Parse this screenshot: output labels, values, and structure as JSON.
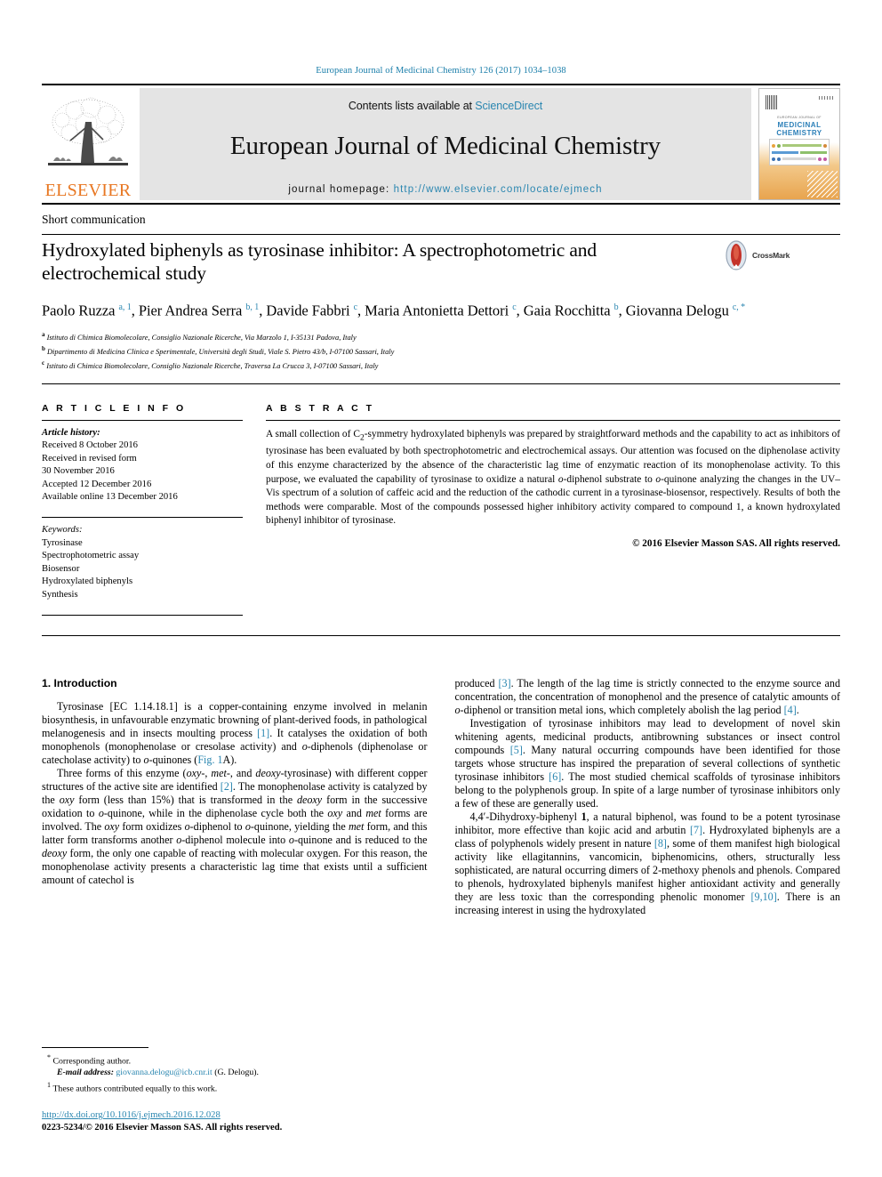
{
  "colors": {
    "link": "#2a86b0",
    "elsevier_orange": "#E87722",
    "band_bg": "#e4e4e4"
  },
  "running_head": "European Journal of Medicinal Chemistry 126 (2017) 1034–1038",
  "masthead": {
    "contents_prefix": "Contents lists available at ",
    "sciencedirect": "ScienceDirect",
    "journal_title": "European Journal of Medicinal Chemistry",
    "homepage_prefix": "journal homepage: ",
    "homepage_url": "http://www.elsevier.com/locate/ejmech",
    "publisher": "ELSEVIER",
    "cover": {
      "line1": "EUROPEAN JOURNAL OF",
      "line2": "MEDICINAL",
      "line3": "CHEMISTRY"
    }
  },
  "article": {
    "type": "Short communication",
    "title": "Hydroxylated biphenyls as tyrosinase inhibitor: A spectrophotometric and electrochemical study",
    "crossmark_label": "CrossMark",
    "authors_html": "Paolo Ruzza <sup>a, 1</sup>, Pier Andrea Serra <sup>b, 1</sup>, Davide Fabbri <sup>c</sup>, Maria Antonietta Dettori <sup>c</sup>, Gaia Rocchitta <sup>b</sup>, Giovanna Delogu <sup>c, *</sup>",
    "affiliations": [
      {
        "mark": "a",
        "text": "Istituto di Chimica Biomolecolare, Consiglio Nazionale Ricerche, Via Marzolo 1, I-35131 Padova, Italy"
      },
      {
        "mark": "b",
        "text": "Dipartimento di Medicina Clinica e Sperimentale, Università degli Studi, Viale S. Pietro 43/b, I-07100 Sassari, Italy"
      },
      {
        "mark": "c",
        "text": "Istituto di Chimica Biomolecolare, Consiglio Nazionale Ricerche, Traversa La Crucca 3, I-07100 Sassari, Italy"
      }
    ]
  },
  "article_info": {
    "heading": "A R T I C L E   I N F O",
    "history_label": "Article history:",
    "history": [
      "Received 8 October 2016",
      "Received in revised form",
      "30 November 2016",
      "Accepted 12 December 2016",
      "Available online 13 December 2016"
    ],
    "keywords_label": "Keywords:",
    "keywords": [
      "Tyrosinase",
      "Spectrophotometric assay",
      "Biosensor",
      "Hydroxylated biphenyls",
      "Synthesis"
    ]
  },
  "abstract": {
    "heading": "A B S T R A C T",
    "text": "A small collection of C2-symmetry hydroxylated biphenyls was prepared by straightforward methods and the capability to act as inhibitors of tyrosinase has been evaluated by both spectrophotometric and electrochemical assays. Our attention was focused on the diphenolase activity of this enzyme characterized by the absence of the characteristic lag time of enzymatic reaction of its monophenolase activity. To this purpose, we evaluated the capability of tyrosinase to oxidize a natural o-diphenol substrate to o-quinone analyzing the changes in the UV–Vis spectrum of a solution of caffeic acid and the reduction of the cathodic current in a tyrosinase-biosensor, respectively. Results of both the methods were comparable. Most of the compounds possessed higher inhibitory activity compared to compound 1, a known hydroxylated biphenyl inhibitor of tyrosinase.",
    "copyright": "© 2016 Elsevier Masson SAS. All rights reserved."
  },
  "body": {
    "section_number_title": "1.  Introduction",
    "left_paragraphs": [
      "Tyrosinase [EC 1.14.18.1] is a copper-containing enzyme involved in melanin biosynthesis, in unfavourable enzymatic browning of plant-derived foods, in pathological melanogenesis and in insects moulting process [1]. It catalyses the oxidation of both monophenols (monophenolase or cresolase activity) and o-diphenols (diphenolase or catecholase activity) to o-quinones (Fig. 1A).",
      "Three forms of this enzyme (oxy-, met-, and deoxy-tyrosinase) with different copper structures of the active site are identified [2]. The monophenolase activity is catalyzed by the oxy form (less than 15%) that is transformed in the deoxy form in the successive oxidation to o-quinone, while in the diphenolase cycle both the oxy and met forms are involved. The oxy form oxidizes o-diphenol to o-quinone, yielding the met form, and this latter form transforms another o-diphenol molecule into o-quinone and is reduced to the deoxy form, the only one capable of reacting with molecular oxygen. For this reason, the monophenolase activity presents a characteristic lag time that exists until a sufficient amount of catechol is"
    ],
    "right_paragraphs": [
      "produced [3]. The length of the lag time is strictly connected to the enzyme source and concentration, the concentration of monophenol and the presence of catalytic amounts of o-diphenol or transition metal ions, which completely abolish the lag period [4].",
      "Investigation of tyrosinase inhibitors may lead to development of novel skin whitening agents, medicinal products, antibrowning substances or insect control compounds [5]. Many natural occurring compounds have been identified for those targets whose structure has inspired the preparation of several collections of synthetic tyrosinase inhibitors [6]. The most studied chemical scaffolds of tyrosinase inhibitors belong to the polyphenols group. In spite of a large number of tyrosinase inhibitors only a few of these are generally used.",
      "4,4′-Dihydroxy-biphenyl 1, a natural biphenol, was found to be a potent tyrosinase inhibitor, more effective than kojic acid and arbutin [7]. Hydroxylated biphenyls are a class of polyphenols widely present in nature [8], some of them manifest high biological activity like ellagitannins, vancomicin, biphenomicins, others, structurally less sophisticated, are natural occurring dimers of 2-methoxy phenols and phenols. Compared to phenols, hydroxylated biphenyls manifest higher antioxidant activity and generally they are less toxic than the corresponding phenolic monomer [9,10]. There is an increasing interest in using the hydroxylated"
    ]
  },
  "footnotes": {
    "corresponding": "Corresponding author.",
    "email_label": "E-mail address:",
    "email": "giovanna.delogu@icb.cnr.it",
    "email_suffix": "(G. Delogu).",
    "equal_contrib": "These authors contributed equally to this work.",
    "doi": "http://dx.doi.org/10.1016/j.ejmech.2016.12.028",
    "issn": "0223-5234/© 2016 Elsevier Masson SAS. All rights reserved."
  }
}
